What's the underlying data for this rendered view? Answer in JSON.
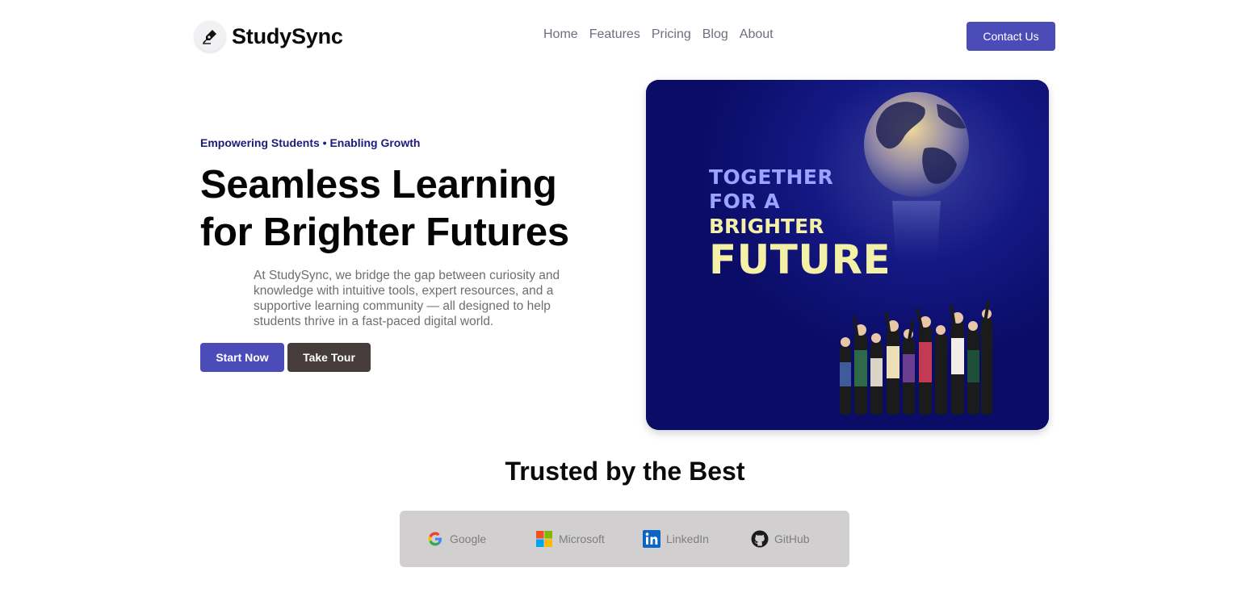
{
  "header": {
    "brand": "StudySync",
    "logo_icon": "pen-nib-icon",
    "nav": [
      "Home",
      "Features",
      "Pricing",
      "Blog",
      "About"
    ],
    "contact_label": "Contact Us"
  },
  "hero": {
    "eyebrow": "Empowering Students • Enabling Growth",
    "headline_line1": "Seamless Learning",
    "headline_line2": "for Brighter Futures",
    "description": "At StudySync, we bridge the gap between curiosity and knowledge with intuitive tools, expert resources, and a supportive learning community — all designed to help students thrive in a fast-paced digital world.",
    "primary_cta": "Start Now",
    "secondary_cta": "Take Tour",
    "image": {
      "text_line1": "TOGETHER",
      "text_line2": "FOR A",
      "text_line3": "BRIGHTER",
      "text_line4": "FUTURE"
    }
  },
  "trusted": {
    "title": "Trusted by the Best",
    "logos": [
      {
        "name": "Google",
        "icon": "google-icon"
      },
      {
        "name": "Microsoft",
        "icon": "microsoft-icon"
      },
      {
        "name": "LinkedIn",
        "icon": "linkedin-icon"
      },
      {
        "name": "GitHub",
        "icon": "github-icon"
      }
    ]
  },
  "colors": {
    "accent": "#4c4cb8",
    "secondary_button": "#463c3c",
    "eyebrow": "#1c1c7a",
    "hero_image_bg": "#0c0f6e",
    "logos_panel": "#d1cfcf"
  }
}
